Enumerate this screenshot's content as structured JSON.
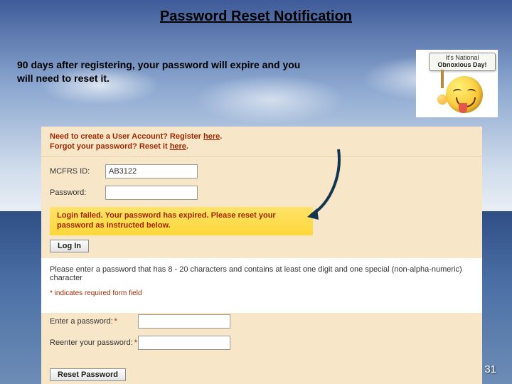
{
  "title": "Password Reset Notification",
  "intro": "90 days after registering, your password will expire and you will need to reset it.",
  "smiley_sign": {
    "line1": "It's National",
    "line2": "Obnoxious Day!"
  },
  "login_help": {
    "register_prefix": "Need to create a User Account? Register ",
    "register_link": "here",
    "forgot_prefix": "Forgot your password? Reset it ",
    "forgot_link": "here"
  },
  "fields": {
    "id_label": "MCFRS ID:",
    "id_value": "AB3122",
    "pw_label": "Password:"
  },
  "error_msg": "Login failed. Your password has expired. Please reset your password as instructed below.",
  "login_button": "Log In",
  "pw_rules": "Please enter a password that has 8 - 20 characters and contains at least one digit and one special (non-alpha-numeric) character",
  "required_note": "* indicates required form field",
  "reset": {
    "enter_label": "Enter a password:",
    "reenter_label": "Reenter your password:",
    "button": "Reset Password"
  },
  "page_number": "31"
}
